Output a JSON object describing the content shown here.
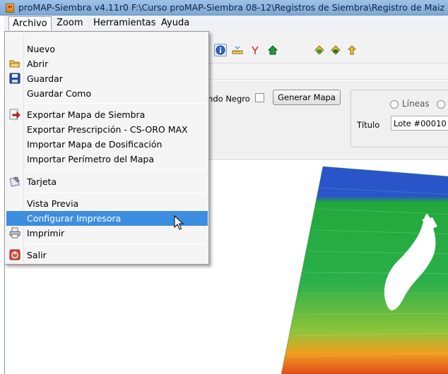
{
  "window": {
    "title": "proMAP-Siembra v4.11r0   F:\\Curso proMAP-Siembra 08-12\\Registros de Siembra\\Registro de Maiz"
  },
  "menubar": {
    "items": [
      "Archivo",
      "Zoom",
      "Herramientas",
      "Ayuda"
    ]
  },
  "archivo_menu": {
    "items": [
      {
        "label": "Nuevo",
        "icon": "none"
      },
      {
        "label": "Abrir",
        "icon": "folder-open-icon"
      },
      {
        "label": "Guardar",
        "icon": "floppy-disk-icon"
      },
      {
        "label": "Guardar Como",
        "icon": "none"
      },
      {
        "label": "Exportar Mapa de Siembra",
        "icon": "export-arrow-icon"
      },
      {
        "label": "Exportar Prescripción - CS-ORO MAX",
        "icon": "none"
      },
      {
        "label": "Importar Mapa de Dosificación",
        "icon": "none"
      },
      {
        "label": "Importar Perímetro del Mapa",
        "icon": "none"
      },
      {
        "label": "Tarjeta",
        "icon": "card-icon"
      },
      {
        "label": "Vista Previa",
        "icon": "none"
      },
      {
        "label": "Configurar Impresora",
        "icon": "none",
        "highlighted": true
      },
      {
        "label": "Imprimir",
        "icon": "printer-icon"
      },
      {
        "label": "Salir",
        "icon": "exit-icon"
      }
    ]
  },
  "options_panel": {
    "fondo_negro_label": "ondo Negro",
    "fondo_negro_checked": false,
    "generar_mapa_label": "Generar Mapa",
    "radio_lineas_label": "Líneas",
    "titulo_label": "Título",
    "titulo_value": "Lote #00010"
  },
  "colors": {
    "menu_highlight": "#3d8ee0",
    "map_green": "#22a83a",
    "map_blue": "#2a55c8",
    "map_red": "#e03a1a"
  }
}
